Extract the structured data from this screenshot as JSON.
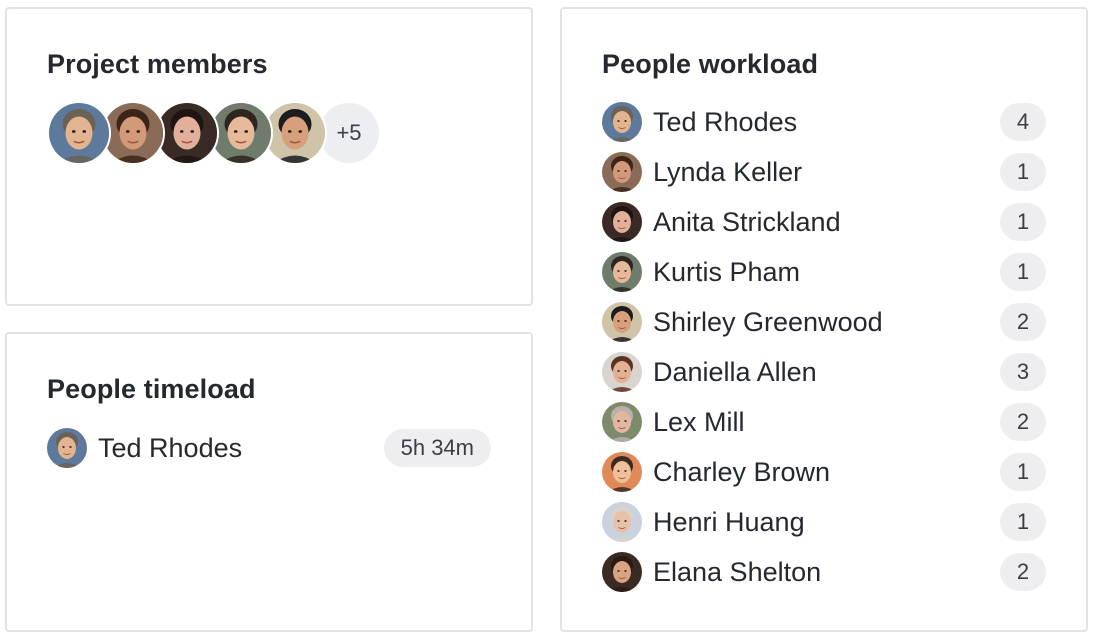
{
  "members_card": {
    "title": "Project members",
    "more_count": "+5",
    "avatars": [
      {
        "icon": "avatar-ted-rhodes",
        "bg": "#5d7a9c",
        "skin": "#e2b48f",
        "hair": "#6b6157"
      },
      {
        "icon": "avatar-lynda-keller",
        "bg": "#8a6b57",
        "skin": "#d29a78",
        "hair": "#3b2418"
      },
      {
        "icon": "avatar-anita-strickland",
        "bg": "#3a2a26",
        "skin": "#e2b09a",
        "hair": "#1e1512"
      },
      {
        "icon": "avatar-kurtis-pham",
        "bg": "#6f7c6c",
        "skin": "#e6b99a",
        "hair": "#2e2521"
      },
      {
        "icon": "avatar-shirley-greenwood",
        "bg": "#cfc3a8",
        "skin": "#d7a07a",
        "hair": "#1c1c1c"
      }
    ]
  },
  "timeload_card": {
    "title": "People timeload",
    "rows": [
      {
        "name": "Ted Rhodes",
        "value": "5h 34m",
        "bg": "#5d7a9c",
        "skin": "#e2b48f",
        "hair": "#6b6157"
      }
    ]
  },
  "workload_card": {
    "title": "People workload",
    "rows": [
      {
        "name": "Ted Rhodes",
        "count": "4",
        "bg": "#5d7a9c",
        "skin": "#e2b48f",
        "hair": "#6b6157"
      },
      {
        "name": "Lynda Keller",
        "count": "1",
        "bg": "#8a6b57",
        "skin": "#d29a78",
        "hair": "#3b2418"
      },
      {
        "name": "Anita Strickland",
        "count": "1",
        "bg": "#3a2a26",
        "skin": "#e2b09a",
        "hair": "#1e1512"
      },
      {
        "name": "Kurtis Pham",
        "count": "1",
        "bg": "#6f7c6c",
        "skin": "#e6b99a",
        "hair": "#2e2521"
      },
      {
        "name": "Shirley Greenwood",
        "count": "2",
        "bg": "#cfc3a8",
        "skin": "#d7a07a",
        "hair": "#1c1c1c"
      },
      {
        "name": "Daniella Allen",
        "count": "3",
        "bg": "#d8d4d0",
        "skin": "#e3b096",
        "hair": "#5a3220"
      },
      {
        "name": "Lex Mill",
        "count": "2",
        "bg": "#7d8b6a",
        "skin": "#e2b7a0",
        "hair": "#b9b2aa"
      },
      {
        "name": "Charley Brown",
        "count": "1",
        "bg": "#e08a5a",
        "skin": "#f0c09a",
        "hair": "#3a2a22"
      },
      {
        "name": "Henri Huang",
        "count": "1",
        "bg": "#c9d2de",
        "skin": "#e8c2a8",
        "hair": "#d7d2cc"
      },
      {
        "name": "Elana Shelton",
        "count": "2",
        "bg": "#3a2a24",
        "skin": "#d9a384",
        "hair": "#2a1a14"
      }
    ]
  }
}
